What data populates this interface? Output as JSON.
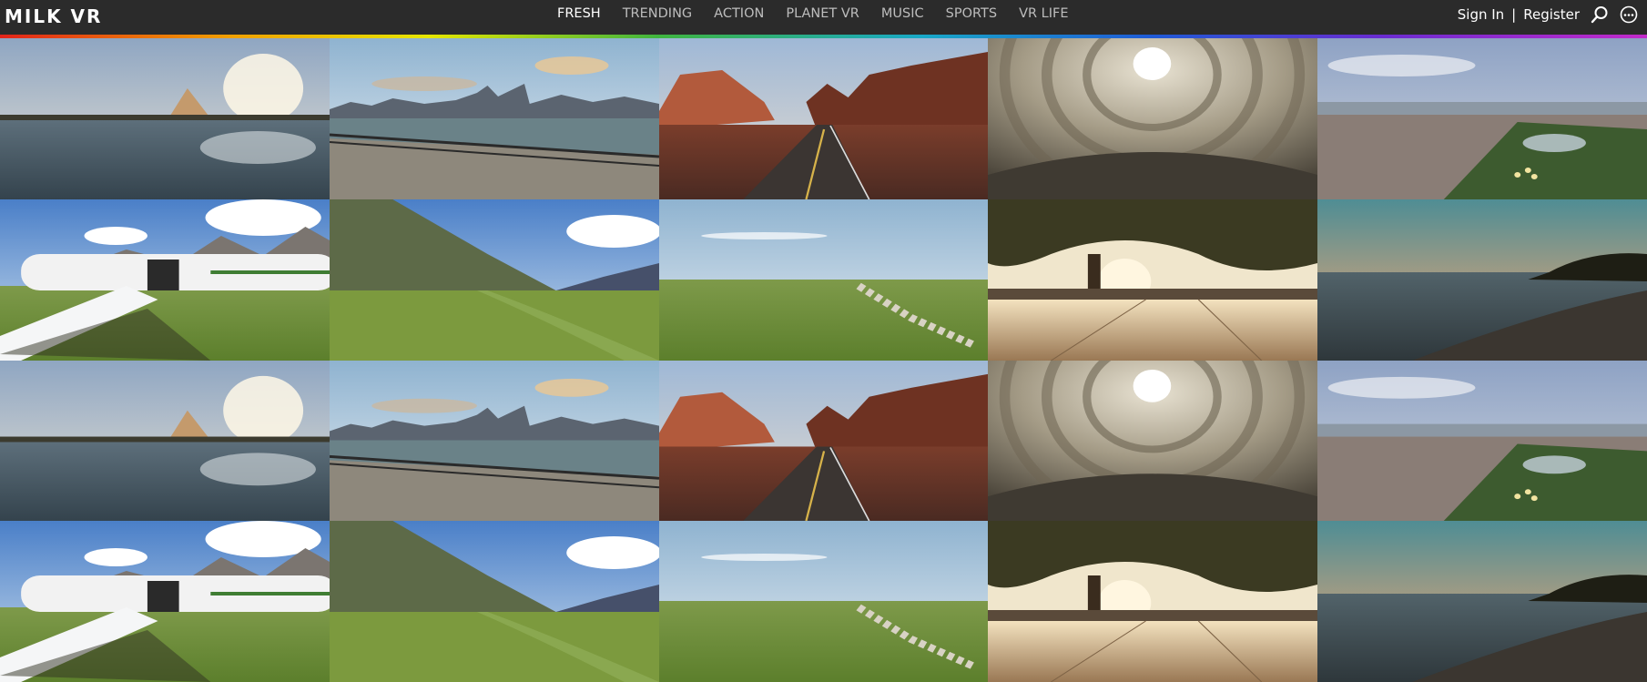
{
  "header": {
    "logo": "MILK VR",
    "nav": [
      {
        "label": "FRESH",
        "active": true
      },
      {
        "label": "TRENDING",
        "active": false
      },
      {
        "label": "ACTION",
        "active": false
      },
      {
        "label": "PLANET VR",
        "active": false
      },
      {
        "label": "MUSIC",
        "active": false
      },
      {
        "label": "SPORTS",
        "active": false
      },
      {
        "label": "VR LIFE",
        "active": false
      }
    ],
    "sign_in": "Sign In",
    "separator": "|",
    "register": "Register",
    "icons": [
      "search-icon",
      "more-icon"
    ]
  },
  "theme": {
    "header_bg": "#2b2b2b",
    "rainbow": [
      "#e2231a",
      "#f0a000",
      "#e6e600",
      "#3fb43f",
      "#18a8c8",
      "#1f5ad6",
      "#6a2bd1",
      "#c22ac9"
    ]
  },
  "grid": {
    "columns": 5,
    "rows": 4,
    "tiles": [
      {
        "scene": "lake-pyramid"
      },
      {
        "scene": "harbor-skyline"
      },
      {
        "scene": "desert-road"
      },
      {
        "scene": "dome-ceiling"
      },
      {
        "scene": "city-park-aerial"
      },
      {
        "scene": "plane-mountains"
      },
      {
        "scene": "alpine-valley"
      },
      {
        "scene": "grassland-sheep"
      },
      {
        "scene": "tree-terrace"
      },
      {
        "scene": "beach-sunset"
      },
      {
        "scene": "lake-pyramid"
      },
      {
        "scene": "harbor-skyline"
      },
      {
        "scene": "desert-road"
      },
      {
        "scene": "dome-ceiling"
      },
      {
        "scene": "city-park-aerial"
      },
      {
        "scene": "plane-mountains"
      },
      {
        "scene": "alpine-valley"
      },
      {
        "scene": "grassland-sheep"
      },
      {
        "scene": "tree-terrace"
      },
      {
        "scene": "beach-sunset"
      }
    ]
  }
}
